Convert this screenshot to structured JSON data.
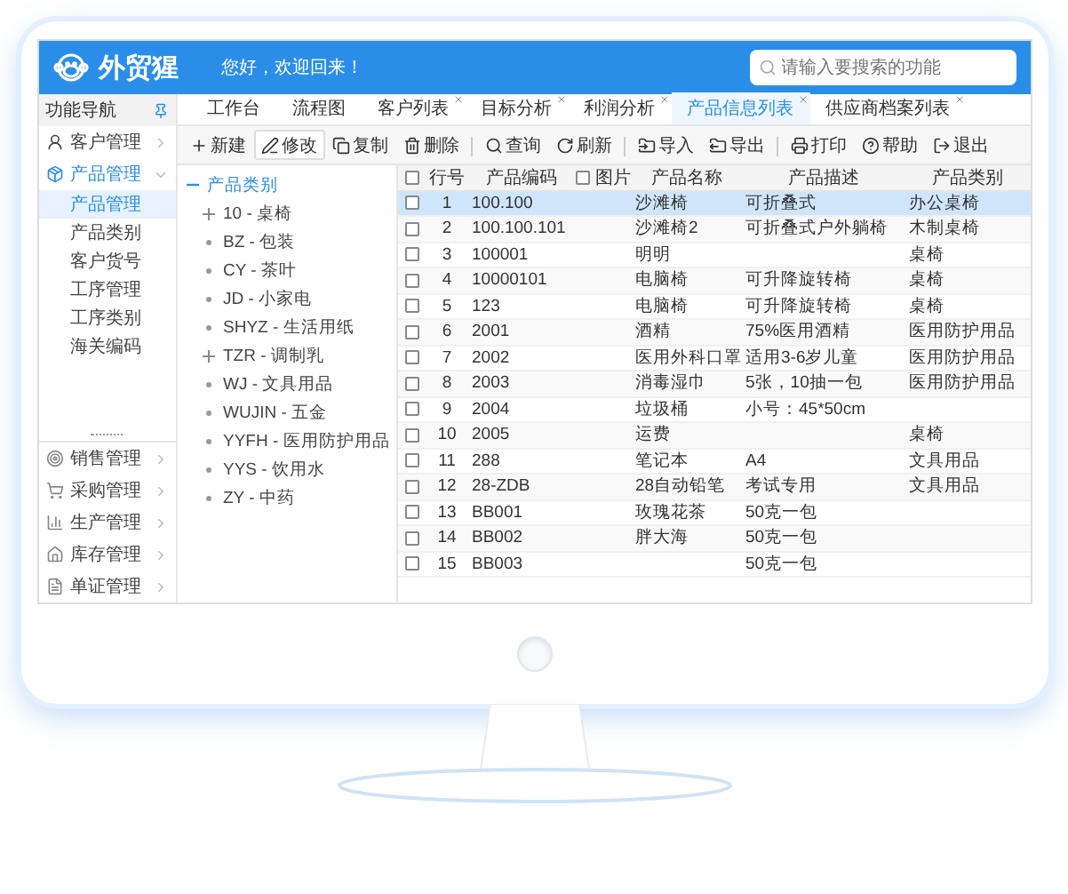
{
  "header": {
    "logo": "外贸猩",
    "greeting": "您好，欢迎回来！",
    "search": {
      "placeholder": "请输入要搜索的功能"
    }
  },
  "nav": {
    "title": "功能导航",
    "items": [
      {
        "label": "客户管理",
        "expanded": false
      },
      {
        "label": "产品管理",
        "expanded": true,
        "children": [
          {
            "label": "产品管理",
            "selected": true
          },
          {
            "label": "产品类别",
            "selected": false
          },
          {
            "label": "客户货号",
            "selected": false
          },
          {
            "label": "工序管理",
            "selected": false
          },
          {
            "label": "工序类别",
            "selected": false
          },
          {
            "label": "海关编码",
            "selected": false
          }
        ]
      }
    ],
    "bottom_items": [
      {
        "label": "销售管理",
        "expanded": false
      },
      {
        "label": "采购管理",
        "expanded": false
      },
      {
        "label": "生产管理",
        "expanded": false
      },
      {
        "label": "库存管理",
        "expanded": false
      },
      {
        "label": "单证管理",
        "expanded": false
      }
    ]
  },
  "tabs": [
    {
      "label": "工作台",
      "selected": false,
      "closable": false
    },
    {
      "label": "流程图",
      "selected": false,
      "closable": false
    },
    {
      "label": "客户列表",
      "selected": false,
      "closable": true
    },
    {
      "label": "目标分析",
      "selected": false,
      "closable": true
    },
    {
      "label": "利润分析",
      "selected": false,
      "closable": true
    },
    {
      "label": "产品信息列表",
      "selected": true,
      "closable": true
    },
    {
      "label": "供应商档案列表",
      "selected": false,
      "closable": true
    }
  ],
  "toolbar": [
    {
      "label": "新建",
      "highlighted": false,
      "divider_after": false
    },
    {
      "label": "修改",
      "highlighted": true,
      "divider_after": false
    },
    {
      "label": "复制",
      "highlighted": false,
      "divider_after": false
    },
    {
      "label": "删除",
      "highlighted": false,
      "divider_after": true
    },
    {
      "label": "查询",
      "highlighted": false,
      "divider_after": false
    },
    {
      "label": "刷新",
      "highlighted": false,
      "divider_after": true
    },
    {
      "label": "导入",
      "highlighted": false,
      "divider_after": false
    },
    {
      "label": "导出",
      "highlighted": false,
      "divider_after": true
    },
    {
      "label": "打印",
      "highlighted": false,
      "divider_after": false
    },
    {
      "label": "帮助",
      "highlighted": false,
      "divider_after": false
    },
    {
      "label": "退出",
      "highlighted": false,
      "divider_after": false
    }
  ],
  "tree": {
    "label": "产品类别",
    "expanded": true,
    "children": [
      {
        "label": "10 - 桌椅",
        "expandable": true
      },
      {
        "label": "BZ - 包装",
        "expandable": false
      },
      {
        "label": "CY - 茶叶",
        "expandable": false
      },
      {
        "label": "JD - 小家电",
        "expandable": false
      },
      {
        "label": "SHYZ - 生活用纸",
        "expandable": false
      },
      {
        "label": "TZR - 调制乳",
        "expandable": true
      },
      {
        "label": "WJ - 文具用品",
        "expandable": false
      },
      {
        "label": "WUJIN - 五金",
        "expandable": false
      },
      {
        "label": "YYFH - 医用防护用品",
        "expandable": false
      },
      {
        "label": "YYS - 饮用水",
        "expandable": false
      },
      {
        "label": "ZY - 中药",
        "expandable": false
      }
    ]
  },
  "table": {
    "header_checked": false,
    "image_header_checked": false,
    "columns": [
      "行号",
      "产品编码",
      "图片",
      "产品名称",
      "产品描述",
      "产品类别"
    ],
    "rows": [
      {
        "cells": [
          "1",
          "100.100",
          "",
          "沙滩椅",
          "可折叠式",
          "办公桌椅"
        ],
        "selected": true,
        "checked": false
      },
      {
        "cells": [
          "2",
          "100.100.101",
          "",
          "沙滩椅2",
          "可折叠式户外躺椅",
          "木制桌椅"
        ],
        "selected": false,
        "checked": false
      },
      {
        "cells": [
          "3",
          "100001",
          "",
          "明明",
          "",
          "桌椅"
        ],
        "selected": false,
        "checked": false
      },
      {
        "cells": [
          "4",
          "10000101",
          "",
          "电脑椅",
          "可升降旋转椅",
          "桌椅"
        ],
        "selected": false,
        "checked": false
      },
      {
        "cells": [
          "5",
          "123",
          "",
          "电脑椅",
          "可升降旋转椅",
          "桌椅"
        ],
        "selected": false,
        "checked": false
      },
      {
        "cells": [
          "6",
          "2001",
          "",
          "酒精",
          "75%医用酒精",
          "医用防护用品"
        ],
        "selected": false,
        "checked": false
      },
      {
        "cells": [
          "7",
          "2002",
          "",
          "医用外科口罩",
          "适用3-6岁儿童",
          "医用防护用品"
        ],
        "selected": false,
        "checked": false
      },
      {
        "cells": [
          "8",
          "2003",
          "",
          "消毒湿巾",
          "5张，10抽一包",
          "医用防护用品"
        ],
        "selected": false,
        "checked": false
      },
      {
        "cells": [
          "9",
          "2004",
          "",
          "垃圾桶",
          "小号：45*50cm",
          ""
        ],
        "selected": false,
        "checked": false
      },
      {
        "cells": [
          "10",
          "2005",
          "",
          "运费",
          "",
          "桌椅"
        ],
        "selected": false,
        "checked": false
      },
      {
        "cells": [
          "11",
          "288",
          "",
          "笔记本",
          "A4",
          "文具用品"
        ],
        "selected": false,
        "checked": false
      },
      {
        "cells": [
          "12",
          "28-ZDB",
          "",
          "28自动铅笔",
          "考试专用",
          "文具用品"
        ],
        "selected": false,
        "checked": false
      },
      {
        "cells": [
          "13",
          "BB001",
          "",
          "玫瑰花茶",
          "50克一包",
          ""
        ],
        "selected": false,
        "checked": false
      },
      {
        "cells": [
          "14",
          "BB002",
          "",
          "胖大海",
          "50克一包",
          ""
        ],
        "selected": false,
        "checked": false
      },
      {
        "cells": [
          "15",
          "BB003",
          "",
          "",
          "50克一包",
          ""
        ],
        "selected": false,
        "checked": false
      }
    ]
  }
}
